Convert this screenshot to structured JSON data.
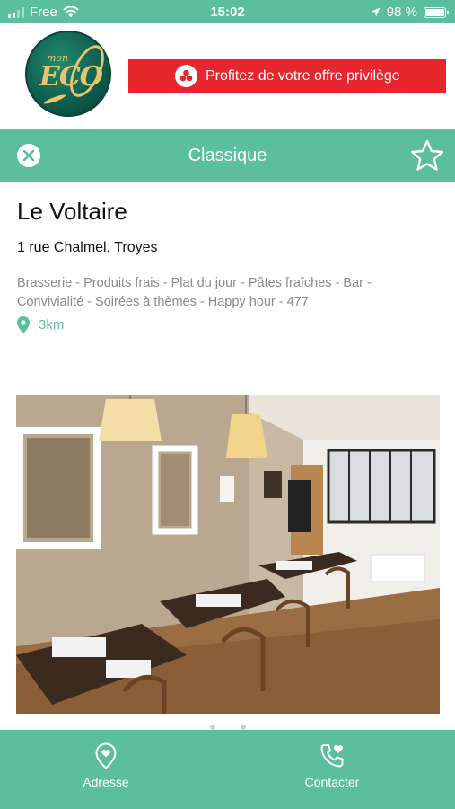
{
  "status_bar": {
    "carrier": "Free",
    "time": "15:02",
    "battery": "98 %",
    "battery_level": 0.98
  },
  "logo": {
    "small": "mon",
    "main": "ECO"
  },
  "promo": {
    "label": "Profitez de votre offre privilège"
  },
  "title_bar": {
    "title": "Classique",
    "close_icon": "close-circle-icon",
    "favorite_icon": "star-outline-icon"
  },
  "restaurant": {
    "name": "Le Voltaire",
    "address": "1 rue Chalmel, Troyes",
    "tags": "Brasserie - Produits frais - Plat du jour - Pâtes fraîches - Bar - Convivialité - Soirées à thèmes - Happy hour - 477",
    "distance": "3km"
  },
  "gallery": {
    "page_count": 2
  },
  "bottom_bar": {
    "tabs": [
      {
        "label": "Adresse",
        "icon": "location-heart-icon"
      },
      {
        "label": "Contacter",
        "icon": "phone-heart-icon"
      }
    ]
  },
  "colors": {
    "accent": "#5bbf9c",
    "promo": "#e8262d",
    "tag_text": "#8a8a8a"
  }
}
